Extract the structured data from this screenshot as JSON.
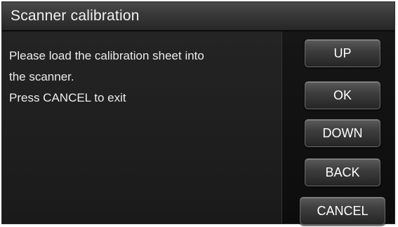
{
  "window": {
    "title": "Scanner calibration"
  },
  "message": {
    "lines": [
      "Please load the calibration sheet into",
      "the scanner.",
      "Press CANCEL to exit"
    ]
  },
  "buttons": {
    "up": "UP",
    "ok": "OK",
    "down": "DOWN",
    "back": "BACK",
    "cancel": "CANCEL"
  },
  "colors": {
    "background": "#1a1a1a",
    "titlebar": "#383838",
    "text": "#ececec",
    "button": "#3e3e3e"
  }
}
